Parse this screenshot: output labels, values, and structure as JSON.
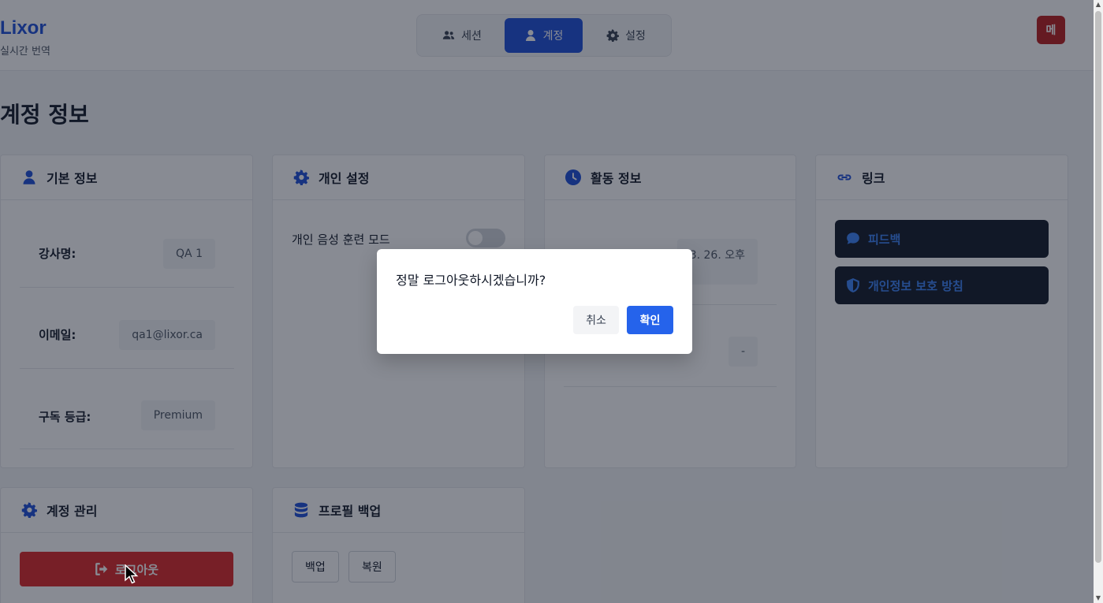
{
  "header": {
    "brand_name": "Lixor",
    "brand_sub": "실시간 번역",
    "tabs": [
      {
        "label": "세션",
        "icon": "users-icon"
      },
      {
        "label": "계정",
        "icon": "user-icon",
        "active": true
      },
      {
        "label": "설정",
        "icon": "gear-icon"
      }
    ],
    "avatar": "메"
  },
  "page_title": "계정 정보",
  "cards": {
    "basic": {
      "title": "기본 정보",
      "rows": [
        {
          "label": "강사명:",
          "value": "QA 1"
        },
        {
          "label": "이메일:",
          "value": "qa1@lixor.ca"
        },
        {
          "label": "구독 등급:",
          "value": "Premium"
        }
      ]
    },
    "personal": {
      "title": "개인 설정",
      "voice_training_label": "개인 음성 훈련 모드",
      "voice_training_on": false
    },
    "activity": {
      "title": "활동 정보",
      "row1_value": "3. 26. 오후",
      "row2_value": "-"
    },
    "links": {
      "title": "링크",
      "items": [
        "피드백",
        "개인정보 보호 방침"
      ]
    },
    "account": {
      "title": "계정 관리",
      "logout": "로그아웃"
    },
    "backup": {
      "title": "프로필 백업",
      "backup_btn": "백업",
      "restore_btn": "복원"
    }
  },
  "dialog": {
    "message": "정말 로그아웃하시겠습니까?",
    "cancel": "취소",
    "confirm": "확인"
  },
  "colors": {
    "accent": "#1d4ed8",
    "danger": "#dc2626",
    "confirm": "#2563eb"
  }
}
